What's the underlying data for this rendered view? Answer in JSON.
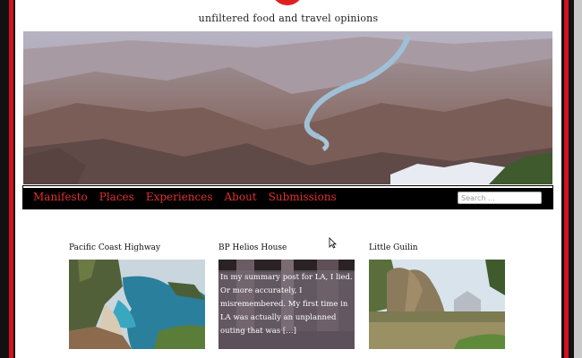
{
  "site": {
    "tagline": "unfiltered food and travel opinions"
  },
  "nav": {
    "items": [
      "Manifesto",
      "Places",
      "Experiences",
      "About",
      "Submissions"
    ],
    "search_placeholder": "Search ..."
  },
  "posts": [
    {
      "title": "Pacific Coast Highway",
      "excerpt": ""
    },
    {
      "title": "BP Helios House",
      "excerpt": "In my summary post for LA, I lied. Or more accurately, I misremembered. My first time in LA was actually an unplanned outing that was […]"
    },
    {
      "title": "Little Guilin",
      "excerpt": ""
    }
  ],
  "colors": {
    "frame_red": "#d2121e",
    "nav_text": "#e23030",
    "nav_bg": "#000000"
  }
}
